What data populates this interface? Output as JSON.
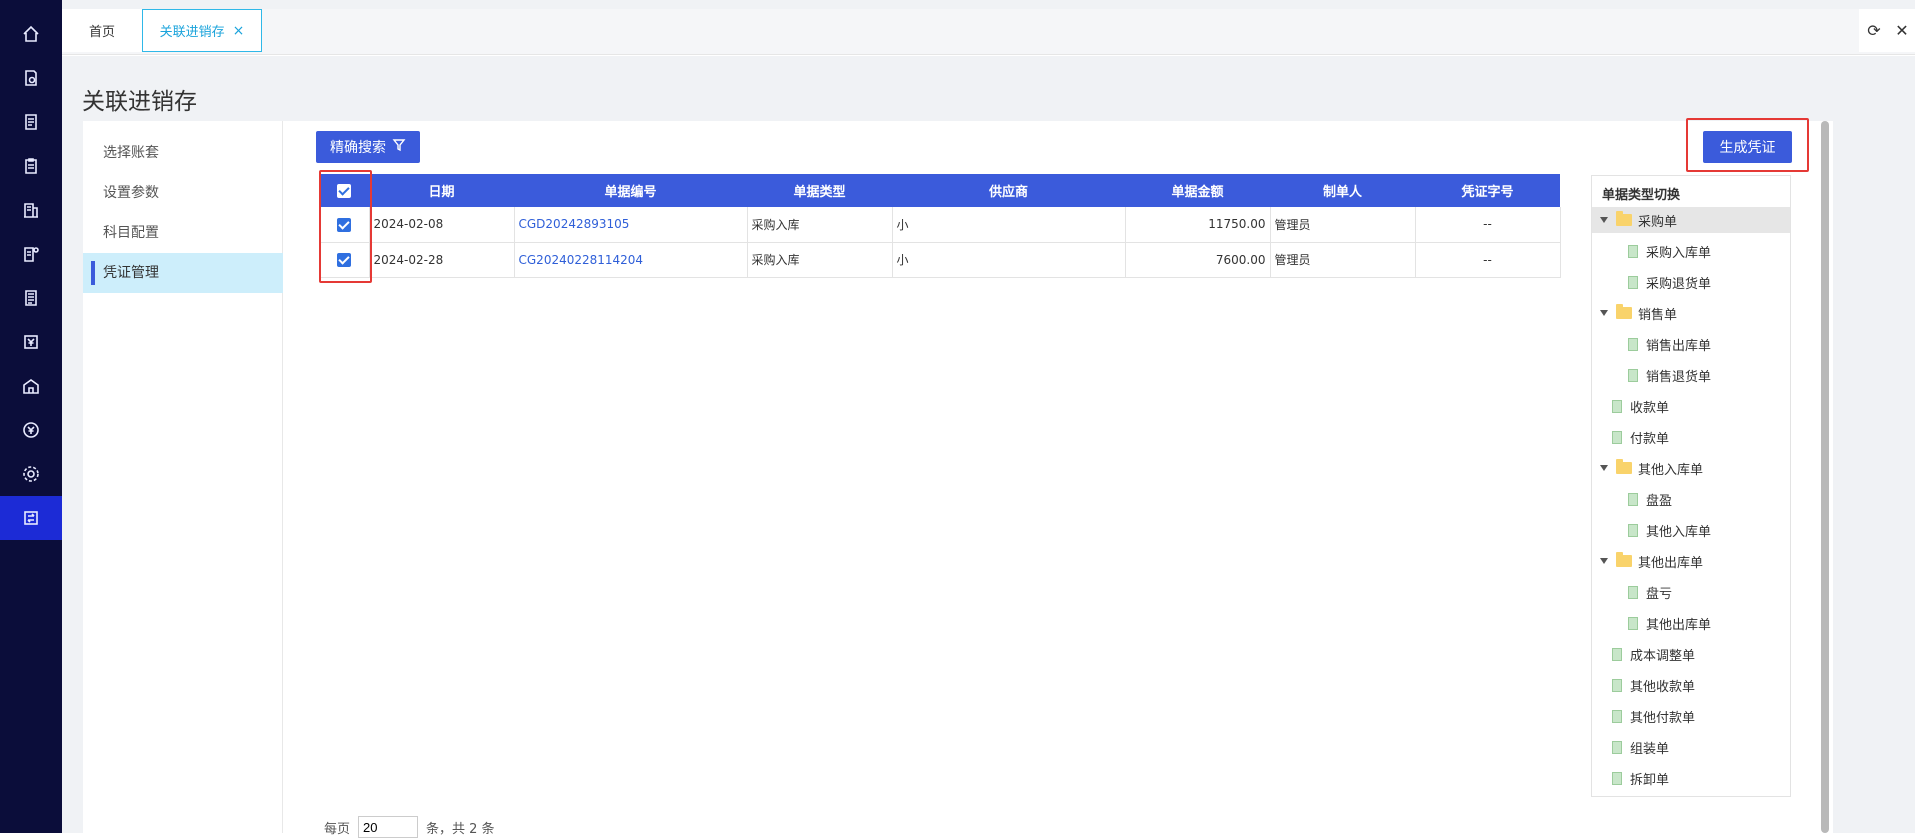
{
  "tabs": {
    "home": "首页",
    "active": "关联进销存",
    "close": "×"
  },
  "page_title": "关联进销存",
  "subnav": [
    "选择账套",
    "设置参数",
    "科目配置",
    "凭证管理"
  ],
  "toolbar": {
    "search_label": "精确搜索",
    "generate_label": "生成凭证"
  },
  "table": {
    "headers": [
      "日期",
      "单据编号",
      "单据类型",
      "供应商",
      "单据金额",
      "制单人",
      "凭证字号"
    ],
    "rows": [
      {
        "date": "2024-02-08",
        "no": "CGD20242893105",
        "type": "采购入库",
        "supplier": "小",
        "amount": "11750.00",
        "maker": "管理员",
        "voucher": "--"
      },
      {
        "date": "2024-02-28",
        "no": "CG20240228114204",
        "type": "采购入库",
        "supplier": "小",
        "amount": "7600.00",
        "maker": "管理员",
        "voucher": "--"
      }
    ]
  },
  "tree": {
    "title": "单据类型切换",
    "nodes": [
      {
        "label": "采购单",
        "kind": "folder"
      },
      {
        "label": "采购入库单",
        "kind": "doc"
      },
      {
        "label": "采购退货单",
        "kind": "doc"
      },
      {
        "label": "销售单",
        "kind": "folder"
      },
      {
        "label": "销售出库单",
        "kind": "doc"
      },
      {
        "label": "销售退货单",
        "kind": "doc"
      },
      {
        "label": "收款单",
        "kind": "doc"
      },
      {
        "label": "付款单",
        "kind": "doc"
      },
      {
        "label": "其他入库单",
        "kind": "folder"
      },
      {
        "label": "盘盈",
        "kind": "doc"
      },
      {
        "label": "其他入库单",
        "kind": "doc"
      },
      {
        "label": "其他出库单",
        "kind": "folder"
      },
      {
        "label": "盘亏",
        "kind": "doc"
      },
      {
        "label": "其他出库单",
        "kind": "doc"
      },
      {
        "label": "成本调整单",
        "kind": "doc"
      },
      {
        "label": "其他收款单",
        "kind": "doc"
      },
      {
        "label": "其他付款单",
        "kind": "doc"
      },
      {
        "label": "组装单",
        "kind": "doc"
      },
      {
        "label": "拆卸单",
        "kind": "doc"
      }
    ]
  },
  "pager": {
    "prefix": "每页",
    "size": "20",
    "suffix": "条，共 2 条"
  },
  "colors": {
    "primary": "#3b5bdb",
    "highlight": "#e53935",
    "sidebar": "#0b0d3a"
  }
}
